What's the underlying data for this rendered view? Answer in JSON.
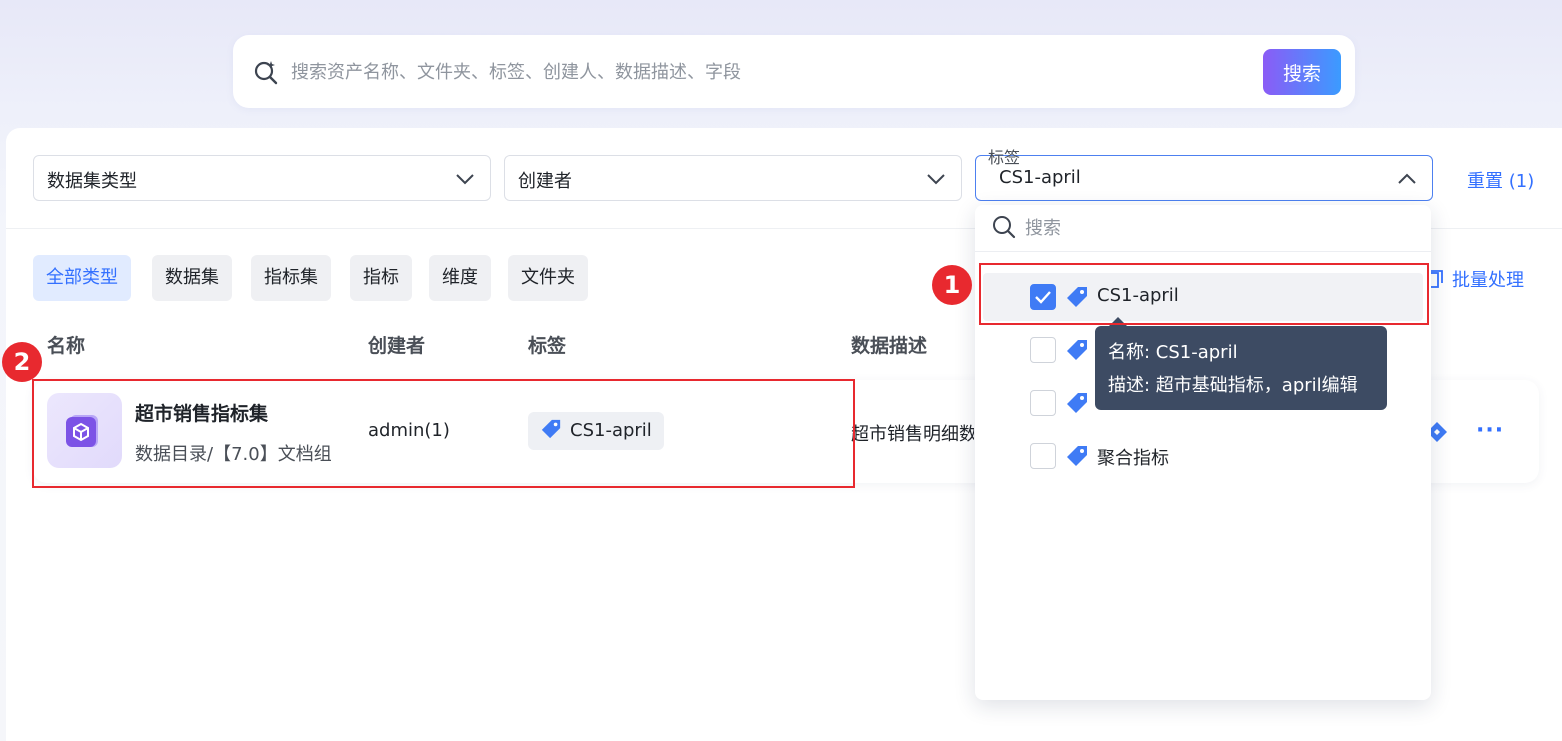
{
  "search": {
    "placeholder": "搜索资产名称、文件夹、标签、创建人、数据描述、字段",
    "button_label": "搜索"
  },
  "filters": {
    "dataset_type": {
      "placeholder": "数据集类型"
    },
    "creator": {
      "placeholder": "创建者"
    },
    "tag": {
      "label": "标签",
      "value": "CS1-april"
    },
    "reset_label": "重置 (1)"
  },
  "type_tabs": [
    {
      "label": "全部类型",
      "active": true
    },
    {
      "label": "数据集"
    },
    {
      "label": "指标集"
    },
    {
      "label": "指标"
    },
    {
      "label": "维度"
    },
    {
      "label": "文件夹"
    }
  ],
  "batch_label": "批量处理",
  "table": {
    "headers": [
      "名称",
      "创建者",
      "标签",
      "数据描述"
    ],
    "rows": [
      {
        "name": "超市销售指标集",
        "path": "数据目录/【7.0】文档组",
        "creator": "admin(1)",
        "tag": "CS1-april",
        "description": "超市销售明细数"
      }
    ]
  },
  "tag_dropdown": {
    "search_placeholder": "搜索",
    "options": [
      {
        "label": "CS1-april",
        "checked": true
      },
      {
        "label": "",
        "checked": false
      },
      {
        "label": "",
        "checked": false
      },
      {
        "label": "聚合指标",
        "checked": false
      }
    ]
  },
  "tooltip": {
    "line1": "名称: CS1-april",
    "line2": "描述: 超市基础指标，april编辑"
  },
  "annotations": {
    "marker1": "1",
    "marker2": "2"
  },
  "colors": {
    "accent": "#3370ff",
    "tag_icon": "#3f7bf5",
    "annotation_red": "#e8292f",
    "tooltip_bg": "#3d4b63",
    "button_gradient_start": "#8b5cf6",
    "button_gradient_end": "#3b9bff"
  },
  "icons": [
    "search-sparkle-icon",
    "chevron-down-icon",
    "chevron-up-icon",
    "search-icon",
    "tag-icon",
    "checkmark-icon",
    "batch-icon",
    "cube-icon",
    "more-icon"
  ]
}
